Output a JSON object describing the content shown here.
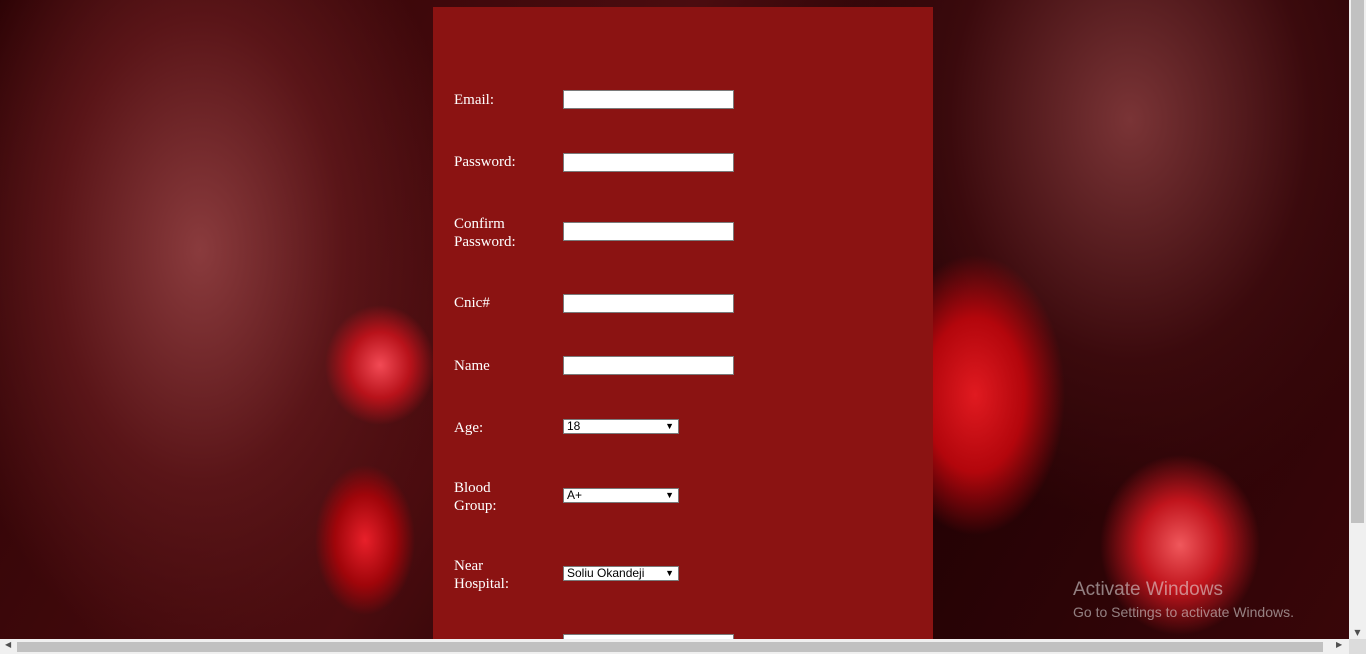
{
  "form": {
    "email_label": "Email:",
    "password_label": "Password:",
    "confirm_password_label_line1": "Confirm",
    "confirm_password_label_line2": "Password:",
    "cnic_label": "Cnic#",
    "name_label": "Name",
    "age_label": "Age:",
    "age_value": "18",
    "blood_group_label_line1": "Blood",
    "blood_group_label_line2": "Group:",
    "blood_group_value": "A+",
    "hospital_label_line1": "Near",
    "hospital_label_line2": "Hospital:",
    "hospital_value": "Soliu Okandeji"
  },
  "icons": {
    "dropdown": "▼",
    "scroll_down": "▼",
    "scroll_left": "◀",
    "scroll_right": "▶"
  },
  "watermark": {
    "title": "Activate Windows",
    "subtitle": "Go to Settings to activate Windows."
  },
  "colors": {
    "panel": "#8b1312",
    "label_text": "#ffffff"
  }
}
